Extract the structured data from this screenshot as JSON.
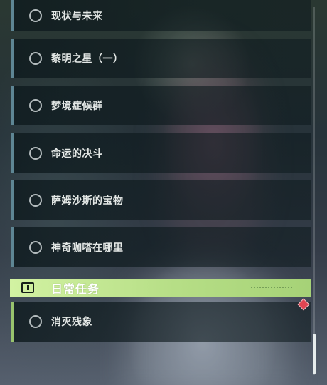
{
  "quests": [
    {
      "label": "现状与未来",
      "icon": "radio-circle-icon"
    },
    {
      "label": "黎明之星（一）",
      "icon": "radio-circle-icon"
    },
    {
      "label": "梦境症候群",
      "icon": "radio-circle-icon"
    },
    {
      "label": "命运的决斗",
      "icon": "radio-circle-icon"
    },
    {
      "label": "萨姆沙斯的宝物",
      "icon": "radio-circle-icon"
    },
    {
      "label": "神奇咖嗒在哪里",
      "icon": "radio-circle-icon"
    }
  ],
  "daily_section": {
    "title": "日常任务",
    "icon": "exclamation-box-icon",
    "accent_color": "#b6de86",
    "items": [
      {
        "label": "消灭残象",
        "icon": "radio-circle-icon",
        "badge": "red-diamond-badge-icon"
      }
    ]
  },
  "colors": {
    "quest_accent": "#5e8694",
    "daily_accent": "#98c36d",
    "badge": "#e04552"
  }
}
